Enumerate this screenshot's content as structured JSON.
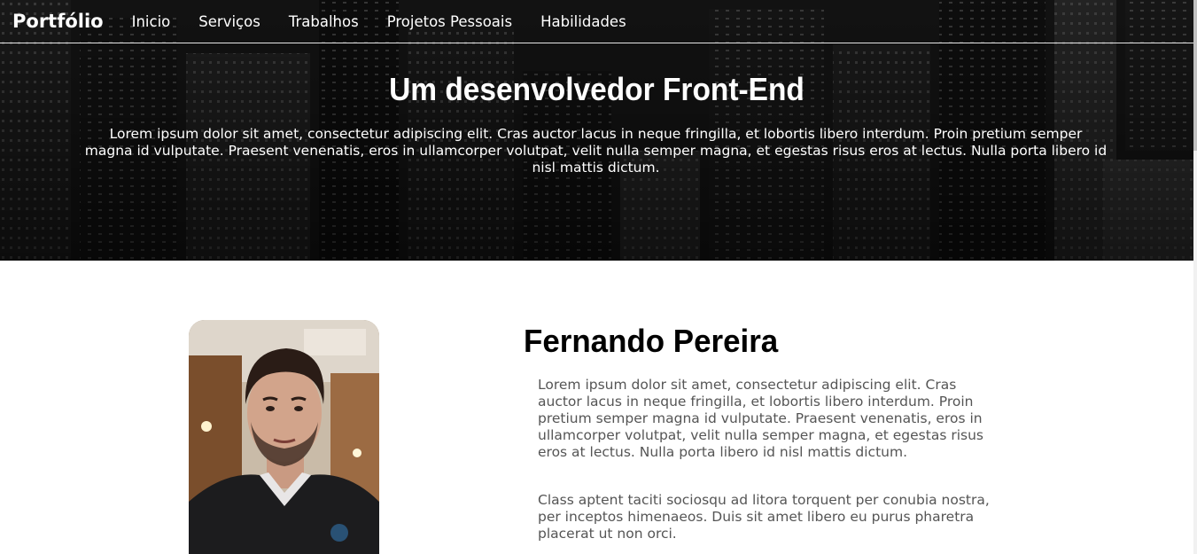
{
  "navbar": {
    "brand": "Portfólio",
    "links": [
      "Inicio",
      "Serviços",
      "Trabalhos",
      "Projetos Pessoais",
      "Habilidades"
    ]
  },
  "hero": {
    "title": "Um desenvolvedor Front-End",
    "text": "Lorem ipsum dolor sit amet, consectetur adipiscing elit. Cras auctor lacus in neque fringilla, et lobortis libero interdum. Proin pretium semper magna id vulputate. Praesent venenatis, eros in ullamcorper volutpat, velit nulla semper magna, et egestas risus eros at lectus. Nulla porta libero id nisl mattis dictum."
  },
  "about": {
    "name": "Fernando Pereira",
    "paragraph1": "Lorem ipsum dolor sit amet, consectetur adipiscing elit. Cras auctor lacus in neque fringilla, et lobortis libero interdum. Proin pretium semper magna id vulputate. Praesent venenatis, eros in ullamcorper volutpat, velit nulla semper magna, et egestas risus eros at lectus. Nulla porta libero id nisl mattis dictum.",
    "paragraph2": "Class aptent taciti sociosqu ad litora torquent per conubia nostra, per inceptos himenaeos. Duis sit amet libero eu purus pharetra placerat ut non orci."
  },
  "colors": {
    "hero_bg": "#1a1a1a",
    "nav_text": "#ffffff",
    "name_text": "#000000",
    "paragraph_text": "#555555"
  }
}
